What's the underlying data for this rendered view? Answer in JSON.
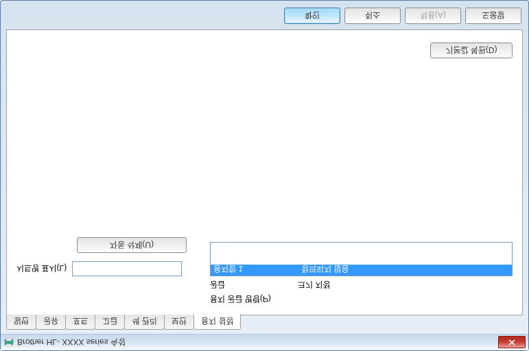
{
  "window": {
    "title": "Brother HL- XXXX  series 속성"
  },
  "tabs": [
    {
      "label": "일반"
    },
    {
      "label": "공유"
    },
    {
      "label": "포트"
    },
    {
      "label": "고급"
    },
    {
      "label": "색 관리"
    },
    {
      "label": "보안"
    },
    {
      "label": "용지 설정"
    }
  ],
  "panel": {
    "columns": {
      "source": "공급",
      "size": "크기 지정"
    },
    "display_name_label": "시트명 표시(L)",
    "display_name_value": "",
    "delete_label": "자동 삭제(U)",
    "list": [
      {
        "source": "용지함 1",
        "size": "정의되지 않음"
      }
    ],
    "reset_label": "기본값 복원(D)",
    "command_label": "용지 공급 명령(P)"
  },
  "buttons": {
    "ok": "확인",
    "cancel": "취소",
    "apply": "적용(A)",
    "help": "도움말"
  }
}
